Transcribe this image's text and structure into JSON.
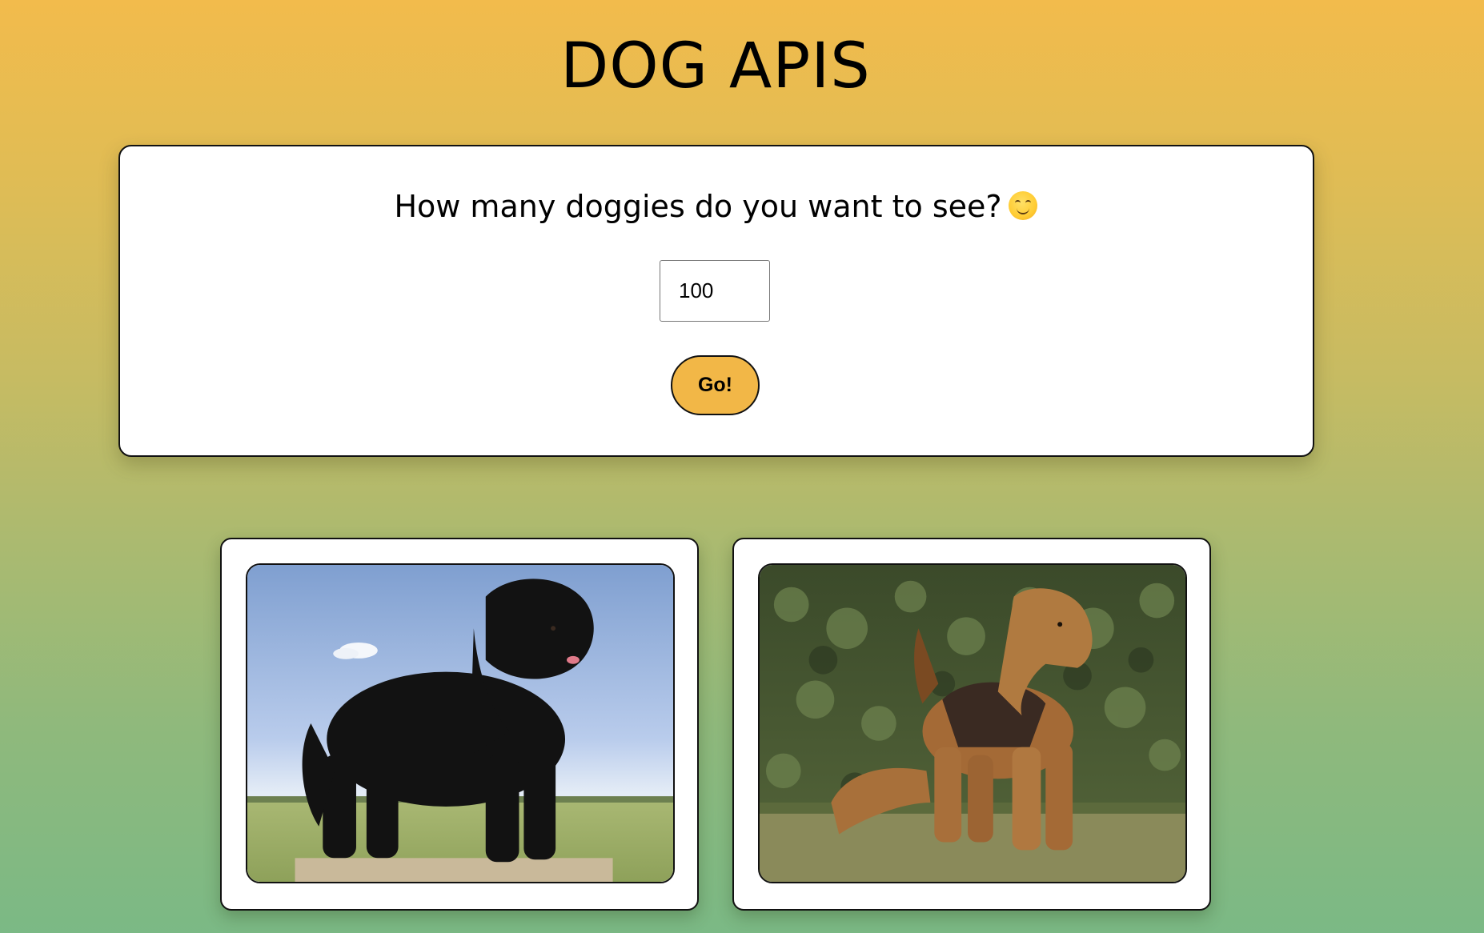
{
  "header": {
    "title": "DOG APIS"
  },
  "form": {
    "question": "How many doggies do you want to see?",
    "question_emoji": "smiling-face-icon",
    "count_value": "100",
    "go_label": "Go!"
  },
  "colors": {
    "background_top": "#f2bb4c",
    "background_bottom": "#7bb985",
    "button": "#f2b747"
  },
  "dogs": [
    {
      "image": "black-newfoundland-dog-photo"
    },
    {
      "image": "airedale-terrier-dog-photo"
    }
  ]
}
